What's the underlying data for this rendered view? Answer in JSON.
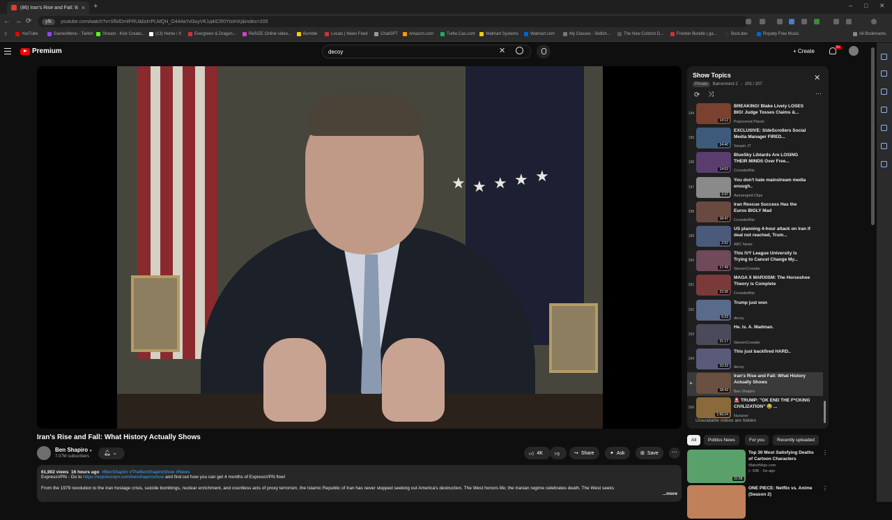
{
  "browser": {
    "tab_title": "(86) Iran's Rise and Fall: Wh",
    "tab_close": "×",
    "new_tab": "+",
    "url_badge": "yfk",
    "url": "youtube.com/watch?v=SflxlDmlPRU&list=PLMQH_O444aYvl3uyVK1q4ICR0YtctHXj&index=205",
    "bookmarks": [
      "YouTube",
      "GamesMenu - Twitch",
      "Stream - Kick Creato...",
      "(13) Home / X",
      "Evergreen & Dragon...",
      "ReSIZE Online video...",
      "Bumble",
      "Locals | News Feed",
      "ChatGPT",
      "Amazon.com",
      "Turbo.Cas.com",
      "Walmart Systems",
      "Walmart.com",
      "My Classes - Skillsh...",
      "The New Colorist D...",
      "Frontier Bundle | ga...",
      "Boot.dev",
      "Royalty Free Music"
    ],
    "all_bookmarks": "All Bookmarks"
  },
  "header": {
    "brand": "Premium",
    "search_query": "decoy",
    "clear": "✕",
    "create_label": "Create",
    "create_plus": "+",
    "notifications": "9+"
  },
  "video": {
    "title": "Iran's Rise and Fall: What History Actually Shows",
    "channel": "Ben Shapiro",
    "verified": "●",
    "subscribers": "7.07M subscribers",
    "subscribe_bell": "🔔︎ ⌄",
    "likes": "4K",
    "like_icon": "👍︎",
    "dislike_icon": "👎︎",
    "share_label": "Share",
    "share_icon": "↪",
    "ask_label": "Ask",
    "ask_icon": "✦",
    "save_label": "Save",
    "save_icon": "⊞",
    "more_icon": "⋯"
  },
  "description": {
    "views": "61,902 views",
    "time": "16 hours ago",
    "tags": "#BenShapiro #TheBenShapiroShow #News",
    "line1_pre": "ExpressVPN - Go to ",
    "line1_link": "https://expressvpn.com/benshapiroshow",
    "line1_post": " and find out how you can get 4 months of ExpressVPN free!",
    "line2": "From the 1979 revolution to the Iran hostage crisis, suicide bombings, nuclear enrichment, and countless acts of proxy terrorism, the Islamic Republic of Iran has never stopped seeking out America's destruction. The West honors life; the Iranian regime celebrates death. The West seeks",
    "more": "...more"
  },
  "playlist": {
    "title": "Show Topics",
    "close": "✕",
    "privacy": "Private",
    "owner": "Barrenmind 2",
    "position": "205 / 207",
    "loop_icon": "⟳",
    "shuffle_icon": "⤨",
    "menu_icon": "⋯",
    "hidden_note": "Unavailable videos are hidden",
    "items": [
      {
        "num": "194",
        "title": "BREAKING! Blake Lively LOSES BIG! Judge Tosses Claims &...",
        "channel": "Popcorned Planet",
        "duration": "14:12",
        "color": "#7a4030"
      },
      {
        "num": "195",
        "title": "EXCLUSIVE: SideScrollers Social Media Manager FIRED...",
        "channel": "Smash JT",
        "duration": "24:40",
        "color": "#3d5a7a"
      },
      {
        "num": "196",
        "title": "BlueSky Libtards Are LOSING THEIR MINDS Over Free...",
        "channel": "CrowderBits",
        "duration": "14:53",
        "color": "#5a3d6e"
      },
      {
        "num": "197",
        "title": "You don't hate mainstream media enough..",
        "channel": "Asmongold Clips",
        "duration": "2:37",
        "color": "#8a8a8a"
      },
      {
        "num": "198",
        "title": "Iran Rescue Success Has the Euros BIGLY Mad",
        "channel": "CrowderBits",
        "duration": "18:47",
        "color": "#6a4a40"
      },
      {
        "num": "199",
        "title": "US planning 4-hour attack on Iran if deal not reached, Trum...",
        "channel": "ABC News",
        "duration": "2:52",
        "color": "#4a5a7a"
      },
      {
        "num": "200",
        "title": "This IVY League University Is Trying to Cancel Change My...",
        "channel": "StevenCrowder",
        "duration": "17:49",
        "color": "#6e4a5a"
      },
      {
        "num": "201",
        "title": "MAGA X MARXISM: The Horseshoe Theory is Complete",
        "channel": "CrowderBits",
        "duration": "22:36",
        "color": "#7a3a3a"
      },
      {
        "num": "202",
        "title": "Trump just won",
        "channel": "decoy",
        "duration": "6:23",
        "color": "#5a6a8a"
      },
      {
        "num": "203",
        "title": "He. Is. A. Madman.",
        "channel": "StevenCrowder",
        "duration": "21:17",
        "color": "#4a4a5a"
      },
      {
        "num": "204",
        "title": "This just backfired HARD..",
        "channel": "decoy",
        "duration": "10:33",
        "color": "#5a5a7a"
      },
      {
        "num": "▶",
        "title": "Iran's Rise and Fall: What History Actually Shows",
        "channel": "Ben Shapiro",
        "duration": "18:43",
        "color": "#6a5040"
      },
      {
        "num": "206",
        "title": "🚨 TRUMP: \"OK END THE F*CKING CIVILIZATION\" 😂 ...",
        "channel": "Nuxanor",
        "duration": "1:56:24",
        "color": "#8a6a3a"
      }
    ]
  },
  "chips": [
    "All",
    "Politics News",
    "For you",
    "Recently uploaded"
  ],
  "recommendations": [
    {
      "title": "Top 30 Most Satisfying Deaths of Cartoon Characters",
      "channel": "WatchMojo.com",
      "meta": "▷ 93K · 2w ago",
      "duration": "31:58",
      "color": "#5aa06a"
    },
    {
      "title": "ONE PIECE: Netflix vs. Anime (Season 2)",
      "channel": "",
      "meta": "",
      "duration": "",
      "color": "#c0805a"
    }
  ],
  "colors": {
    "accent": "#ff0000",
    "link": "#3ea6ff",
    "background": "#0f0f0f"
  }
}
